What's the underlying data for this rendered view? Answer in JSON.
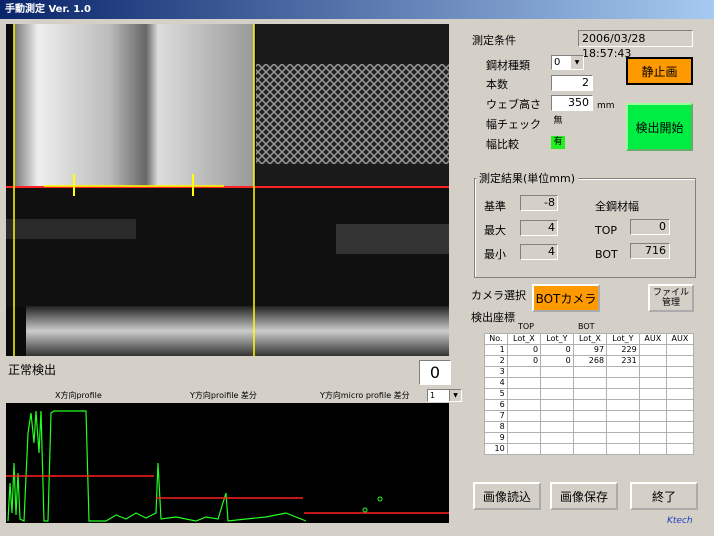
{
  "window": {
    "title": "手動測定 Ver. 1.0"
  },
  "camera": {
    "status_text": "正常検出",
    "count_value": "0"
  },
  "profile": {
    "x_label": "X方向profile",
    "y_label": "Y方向proifile 差分",
    "micro_label": "Y方向micro profile 差分",
    "select_value": "1"
  },
  "conditions": {
    "title": "測定条件",
    "datetime": "2006/03/28 18:57:43",
    "steel_type_label": "鋼材種類",
    "steel_type_value": "0",
    "count_label": "本数",
    "count_value": "2",
    "web_height_label": "ウェブ高さ",
    "web_height_value": "350",
    "web_height_unit": "mm",
    "width_check_label": "幅チェック",
    "width_check_value": "無",
    "width_compare_label": "幅比較",
    "width_compare_value": "有"
  },
  "buttons": {
    "still": "静止画",
    "start": "検出開始",
    "bot_camera": "BOTカメラ",
    "file_mgmt_line1": "ファイル",
    "file_mgmt_line2": "管理",
    "load": "画像読込",
    "save": "画像保存",
    "exit": "終了"
  },
  "results": {
    "title": "測定結果(単位mm)",
    "base_label": "基準",
    "base_value": "-8",
    "max_label": "最大",
    "max_value": "4",
    "min_label": "最小",
    "min_value": "4",
    "all_width_label": "全鋼材幅",
    "top_label": "TOP",
    "top_value": "0",
    "bot_label": "BOT",
    "bot_value": "716"
  },
  "camera_select_label": "カメラ選択",
  "coords": {
    "title": "検出座標",
    "group_top": "TOP",
    "group_bot": "BOT",
    "headers": [
      "No.",
      "Lot_X",
      "Lot_Y",
      "Lot_X",
      "Lot_Y",
      "AUX",
      "AUX"
    ],
    "rows": [
      [
        "1",
        "0",
        "0",
        "97",
        "229",
        "",
        ""
      ],
      [
        "2",
        "0",
        "0",
        "268",
        "231",
        "",
        ""
      ],
      [
        "3",
        "",
        "",
        "",
        "",
        "",
        ""
      ],
      [
        "4",
        "",
        "",
        "",
        "",
        "",
        ""
      ],
      [
        "5",
        "",
        "",
        "",
        "",
        "",
        ""
      ],
      [
        "6",
        "",
        "",
        "",
        "",
        "",
        ""
      ],
      [
        "7",
        "",
        "",
        "",
        "",
        "",
        ""
      ],
      [
        "8",
        "",
        "",
        "",
        "",
        "",
        ""
      ],
      [
        "9",
        "",
        "",
        "",
        "",
        "",
        ""
      ],
      [
        "10",
        "",
        "",
        "",
        "",
        "",
        ""
      ]
    ]
  },
  "brand": "Ktech",
  "colors": {
    "title_start": "#0a246a",
    "button_orange": "#ff9900",
    "button_green": "#00ee44",
    "marker_red": "#ff2020",
    "marker_yellow": "#ffff00",
    "plot_green": "#22ff22"
  }
}
